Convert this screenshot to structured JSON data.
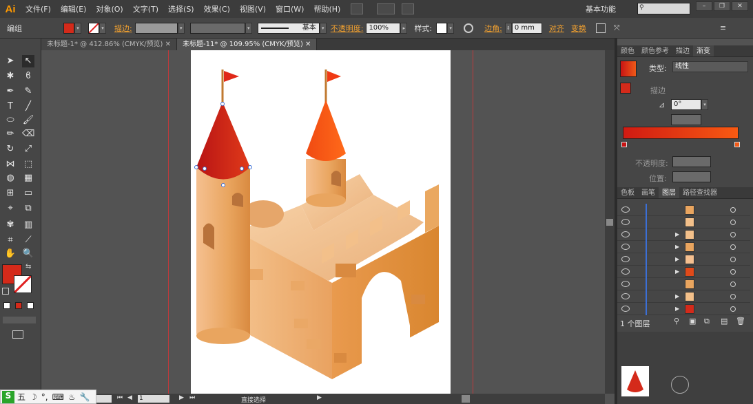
{
  "app": {
    "logo": "Ai"
  },
  "menu": [
    "文件(F)",
    "编辑(E)",
    "对象(O)",
    "文字(T)",
    "选择(S)",
    "效果(C)",
    "视图(V)",
    "窗口(W)",
    "帮助(H)"
  ],
  "workspace": "基本功能",
  "control": {
    "mode": "编组",
    "stroke_label": "描边:",
    "stroke_style": "基本",
    "opacity_label": "不透明度:",
    "opacity_value": "100%",
    "style_label": "样式:",
    "corner_label": "边角:",
    "corner_value": "0 mm",
    "align": "对齐",
    "transform": "变换"
  },
  "tabs": [
    {
      "label": "未标题-1* @ 412.86% (CMYK/预览)"
    },
    {
      "label": "未标题-11* @ 109.95% (CMYK/预览)"
    }
  ],
  "colors": {
    "fill": "#d42a1a",
    "accent": "#f0a030"
  },
  "gradient_panel": {
    "tabs": [
      "颜色",
      "颜色参考",
      "描边",
      "渐变"
    ],
    "type_label": "类型:",
    "type_value": "线性",
    "stroke_label": "描边",
    "angle": "0°",
    "opacity_label": "不透明度:",
    "position_label": "位置:"
  },
  "layers_panel": {
    "tabs": [
      "色板",
      "画笔",
      "图层",
      "路径查找器"
    ],
    "count": "1 个图层"
  },
  "status": {
    "zoom": "1",
    "tool": "直接选择"
  },
  "taskbar": {
    "ime": "五"
  }
}
